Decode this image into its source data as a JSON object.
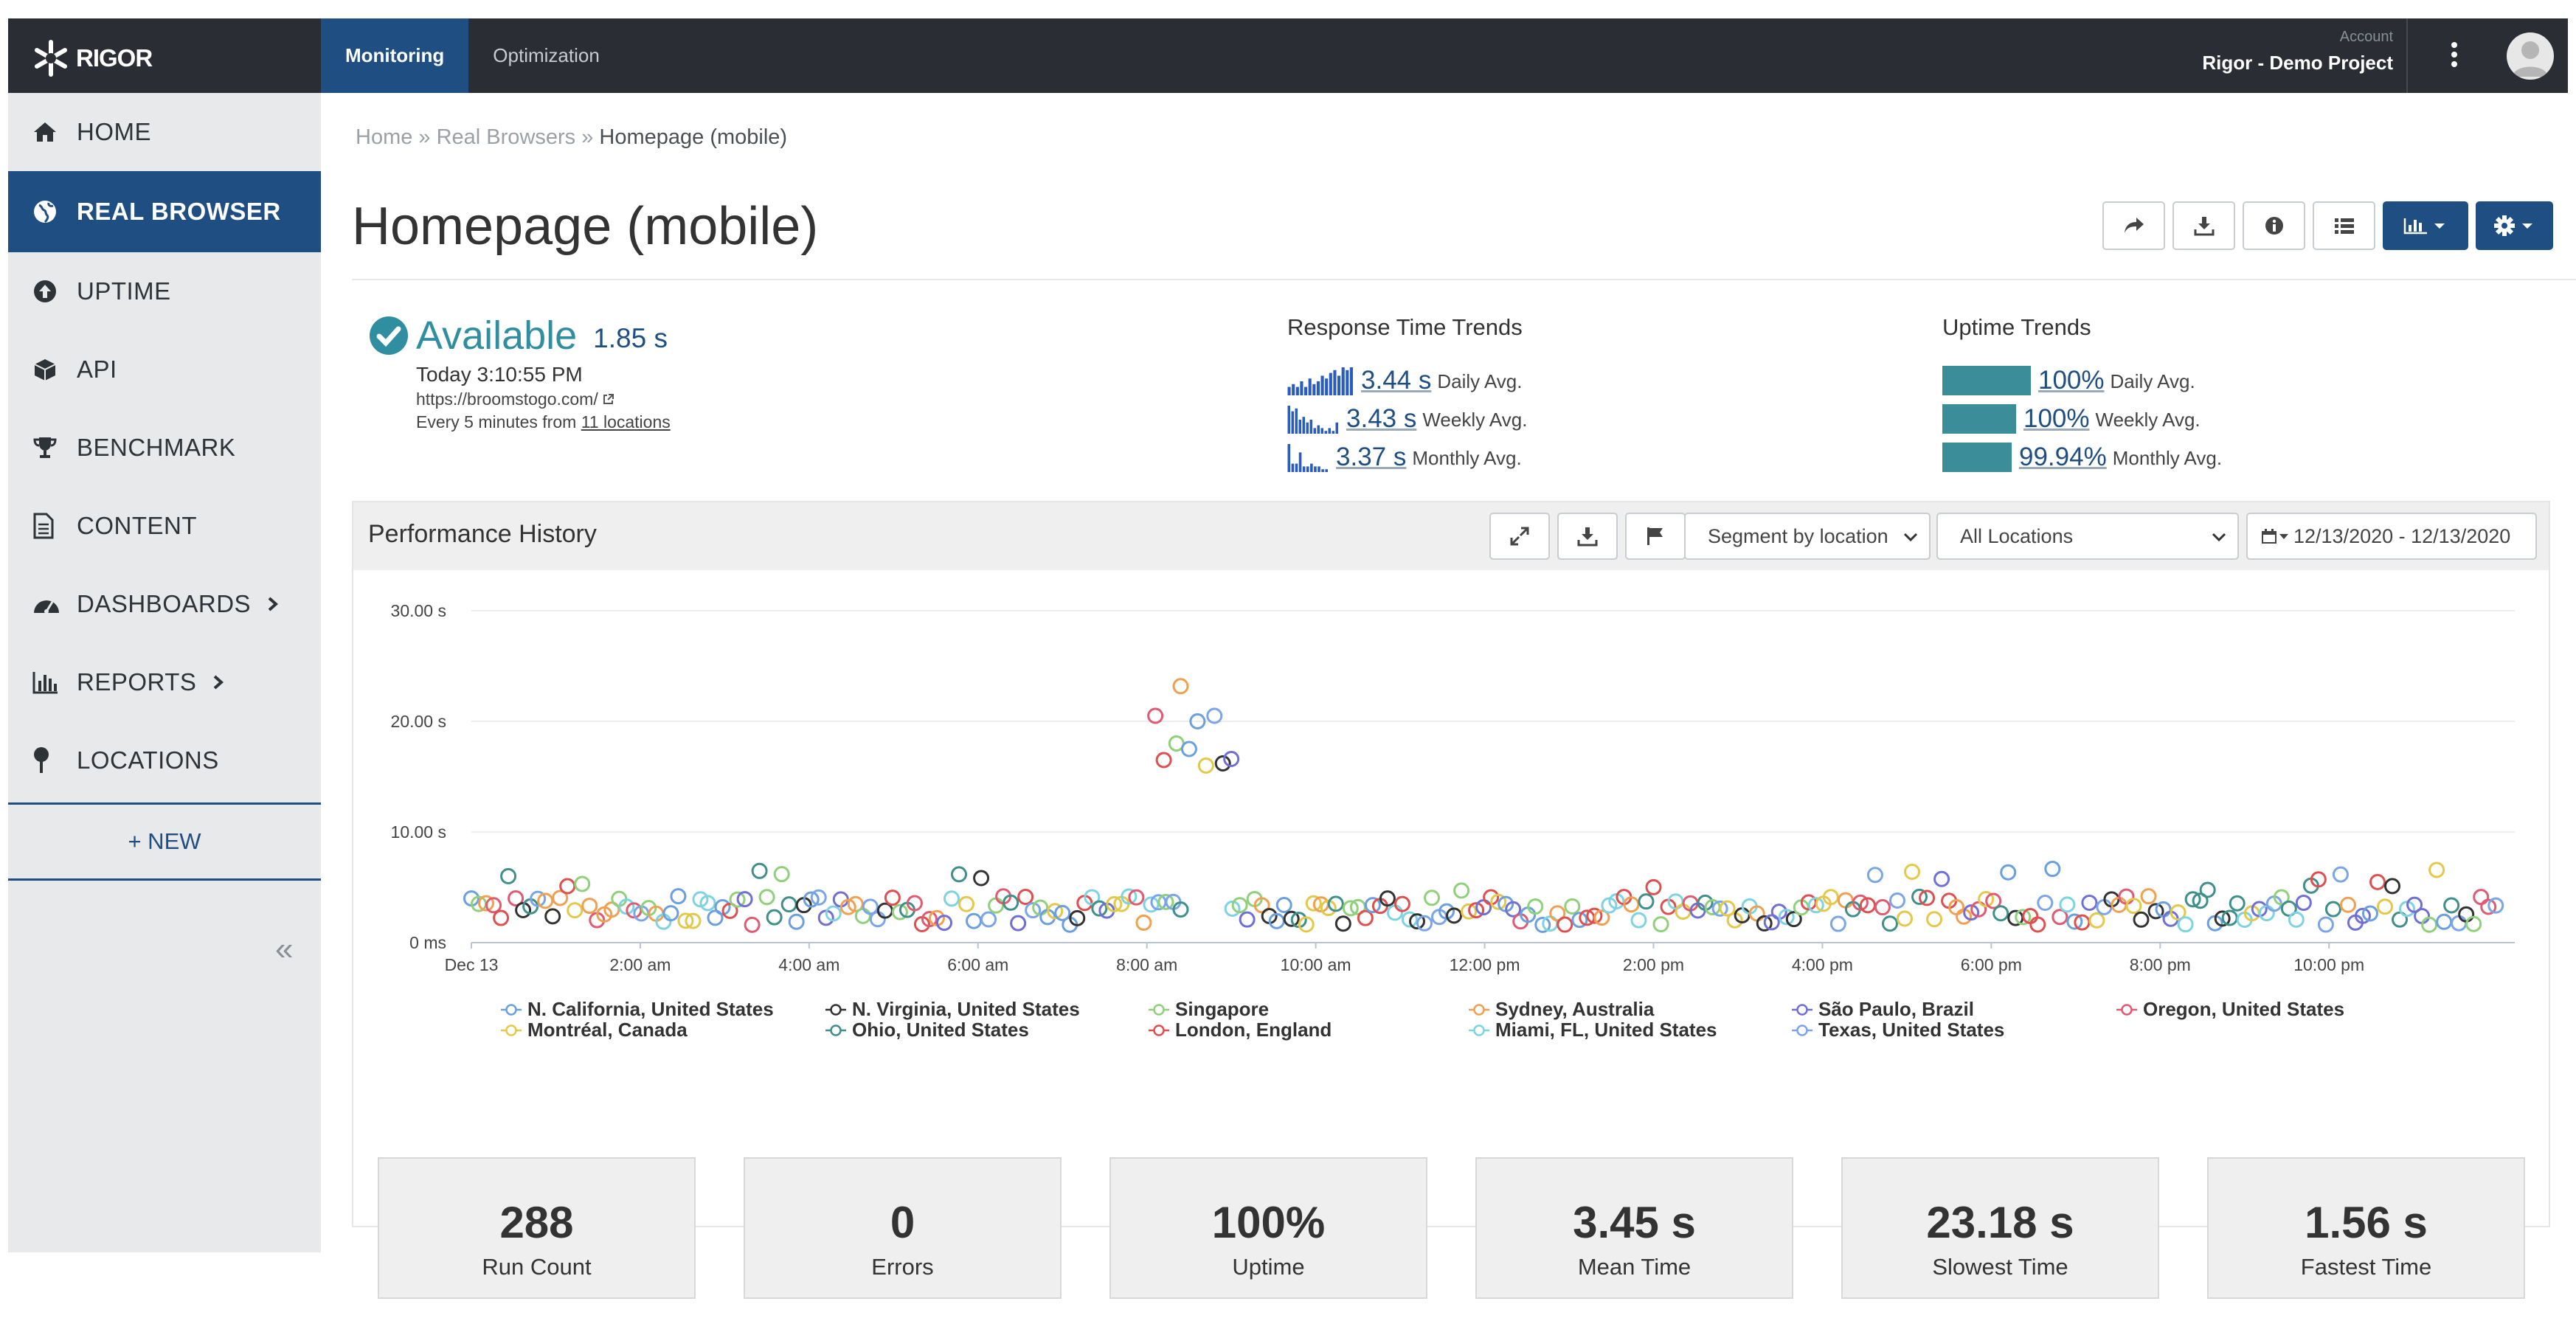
{
  "app": {
    "brand": "RIGOR"
  },
  "topnav": {
    "items": [
      {
        "label": "Monitoring",
        "active": true
      },
      {
        "label": "Optimization",
        "active": false
      }
    ]
  },
  "account": {
    "label": "Account",
    "name": "Rigor - Demo Project"
  },
  "sidebar": {
    "items": [
      {
        "label": "HOME",
        "icon": "home-icon"
      },
      {
        "label": "REAL BROWSER",
        "icon": "globe-icon",
        "active": true
      },
      {
        "label": "UPTIME",
        "icon": "arrow-up-circle-icon"
      },
      {
        "label": "API",
        "icon": "cube-icon"
      },
      {
        "label": "BENCHMARK",
        "icon": "trophy-icon"
      },
      {
        "label": "CONTENT",
        "icon": "document-icon"
      },
      {
        "label": "DASHBOARDS",
        "icon": "dashboard-icon",
        "expandable": true
      },
      {
        "label": "REPORTS",
        "icon": "bar-chart-icon",
        "expandable": true
      },
      {
        "label": "LOCATIONS",
        "icon": "pin-icon"
      }
    ],
    "new_label": "+ NEW",
    "collapse_label": "«"
  },
  "breadcrumb": {
    "home": "Home",
    "sep1": " » ",
    "section": "Real Browsers",
    "sep2": " » ",
    "current": "Homepage (mobile)"
  },
  "page": {
    "title": "Homepage (mobile)"
  },
  "status": {
    "state": "Available",
    "response": "1.85 s",
    "time": "Today 3:10:55 PM",
    "url": "https://broomstogo.com/",
    "frequency_prefix": "Every 5 minutes from ",
    "locations_link": "11 locations"
  },
  "response_trends": {
    "title": "Response Time Trends",
    "rows": [
      {
        "value": "3.44 s",
        "label": "Daily Avg.",
        "spark": [
          3,
          4,
          3,
          5,
          3,
          6,
          4,
          5,
          7,
          6,
          8,
          9,
          7,
          10,
          9,
          10
        ]
      },
      {
        "value": "3.43 s",
        "label": "Weekly Avg.",
        "spark": [
          10,
          8,
          9,
          5,
          6,
          4,
          5,
          2,
          3,
          2,
          1,
          2,
          1,
          4
        ]
      },
      {
        "value": "3.37 s",
        "label": "Monthly Avg.",
        "spark": [
          10,
          3,
          3,
          7,
          2,
          2,
          3,
          2,
          2,
          1,
          1
        ]
      }
    ]
  },
  "uptime_trends": {
    "title": "Uptime Trends",
    "rows": [
      {
        "value": "100%",
        "label": "Daily Avg.",
        "fill": 1.0
      },
      {
        "value": "100%",
        "label": "Weekly Avg.",
        "fill": 1.0
      },
      {
        "value": "99.94%",
        "label": "Monthly Avg.",
        "fill": 0.9994
      }
    ]
  },
  "performance": {
    "title": "Performance History",
    "segment_select": "Segment by location",
    "locations_select": "All Locations",
    "date_range": "12/13/2020 - 12/13/2020"
  },
  "chart_data": {
    "type": "scatter",
    "ylim": [
      0,
      30
    ],
    "yticks": [
      "0 ms",
      "10.00 s",
      "20.00 s",
      "30.00 s"
    ],
    "xticks": [
      "Dec 13",
      "2:00 am",
      "4:00 am",
      "6:00 am",
      "8:00 am",
      "10:00 am",
      "12:00 pm",
      "2:00 pm",
      "4:00 pm",
      "6:00 pm",
      "8:00 pm",
      "10:00 pm"
    ],
    "x_unit": "hours since Dec 13 00:00",
    "series": [
      {
        "name": "N. California, United States",
        "color": "#6a9fe0"
      },
      {
        "name": "N. Virginia, United States",
        "color": "#333333"
      },
      {
        "name": "Singapore",
        "color": "#8fd17a"
      },
      {
        "name": "Sydney, Australia",
        "color": "#f0a050"
      },
      {
        "name": "São Paulo, Brazil",
        "color": "#6f6fd6"
      },
      {
        "name": "Oregon, United States",
        "color": "#e05a72"
      },
      {
        "name": "Montréal, Canada",
        "color": "#e3c84a"
      },
      {
        "name": "Ohio, United States",
        "color": "#3f8f8a"
      },
      {
        "name": "London, England",
        "color": "#e04f4f"
      },
      {
        "name": "Miami, FL, United States",
        "color": "#7dd3e0"
      },
      {
        "name": "Texas, United States",
        "color": "#7aa5e8"
      }
    ],
    "outliers": [
      {
        "x": 8.4,
        "y": 23.18,
        "series": 3
      },
      {
        "x": 8.1,
        "y": 20.5,
        "series": 5
      },
      {
        "x": 8.6,
        "y": 20.0,
        "series": 0
      },
      {
        "x": 8.8,
        "y": 20.5,
        "series": 10
      },
      {
        "x": 8.35,
        "y": 18.0,
        "series": 2
      },
      {
        "x": 8.5,
        "y": 17.5,
        "series": 0
      },
      {
        "x": 8.2,
        "y": 16.5,
        "series": 8
      },
      {
        "x": 8.7,
        "y": 16.0,
        "series": 6
      },
      {
        "x": 8.9,
        "y": 16.2,
        "series": 1
      },
      {
        "x": 9.0,
        "y": 16.6,
        "series": 4
      }
    ]
  },
  "kpis": [
    {
      "value": "288",
      "label": "Run Count"
    },
    {
      "value": "0",
      "label": "Errors"
    },
    {
      "value": "100%",
      "label": "Uptime"
    },
    {
      "value": "3.45 s",
      "label": "Mean Time"
    },
    {
      "value": "23.18 s",
      "label": "Slowest Time"
    },
    {
      "value": "1.56 s",
      "label": "Fastest Time"
    }
  ]
}
